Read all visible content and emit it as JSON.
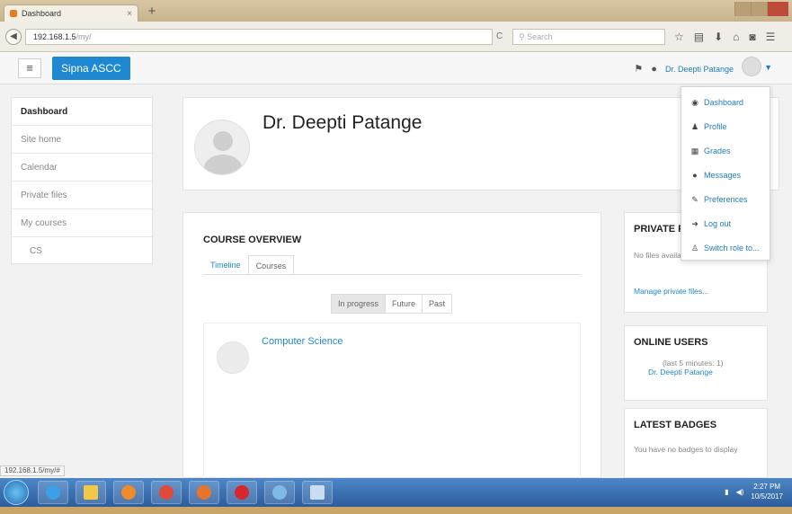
{
  "browser": {
    "tab_title": "Dashboard",
    "tab_close": "×",
    "new_tab": "+",
    "url_host": "192.168.1.5",
    "url_path": "/my/",
    "reload": "C",
    "search_placeholder": "Search",
    "toolbar_icons": [
      "star-icon",
      "library-icon",
      "download-icon",
      "home-icon",
      "pocket-icon",
      "menu-icon"
    ]
  },
  "navbar": {
    "menu_glyph": "≡",
    "site_name": "Sipna ASCC",
    "user_name": "Dr. Deepti Patange"
  },
  "user_menu": [
    {
      "label": "Dashboard",
      "icon": "tachometer-icon"
    },
    {
      "label": "Profile",
      "icon": "user-icon"
    },
    {
      "label": "Grades",
      "icon": "table-icon"
    },
    {
      "label": "Messages",
      "icon": "comment-icon"
    },
    {
      "label": "Preferences",
      "icon": "wrench-icon"
    },
    {
      "label": "Log out",
      "icon": "sign-out-icon"
    },
    {
      "label": "Switch role to...",
      "icon": "user-secret-icon"
    }
  ],
  "left_nav": {
    "items": [
      "Dashboard",
      "Site home",
      "Calendar",
      "Private files",
      "My courses"
    ],
    "sub_items": [
      "CS"
    ]
  },
  "header": {
    "full_name": "Dr. Deepti Patange"
  },
  "course_overview": {
    "title": "COURSE OVERVIEW",
    "tabs": [
      "Timeline",
      "Courses"
    ],
    "filters": [
      "In progress",
      "Future",
      "Past"
    ],
    "course_name": "Computer Science"
  },
  "private_files": {
    "title": "PRIVATE F",
    "empty_text": "No files available",
    "manage_link": "Manage private files..."
  },
  "online_users": {
    "title": "ONLINE USERS",
    "period": "(last 5 minutes: 1)",
    "user": "Dr. Deepti Patange"
  },
  "latest_badges": {
    "title": "LATEST BADGES",
    "empty_text": "You have no badges to display"
  },
  "status_url": "192.168.1.5/my/#",
  "taskbar": {
    "clock_time": "2:27 PM",
    "clock_date": "10/5/2017"
  }
}
